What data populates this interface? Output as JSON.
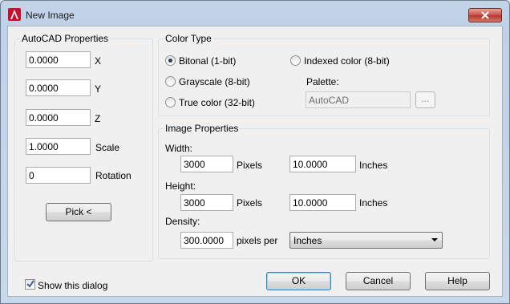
{
  "window": {
    "title": "New Image"
  },
  "insertion": {
    "group_title": "AutoCAD Properties",
    "x": {
      "value": "0.0000",
      "label": "X"
    },
    "y": {
      "value": "0.0000",
      "label": "Y"
    },
    "z": {
      "value": "0.0000",
      "label": "Z"
    },
    "scale": {
      "value": "1.0000",
      "label": "Scale"
    },
    "rotation": {
      "value": "0",
      "label": "Rotation"
    },
    "pick_label": "Pick <"
  },
  "color_type": {
    "group_title": "Color Type",
    "options": [
      {
        "label": "Bitonal (1-bit)",
        "checked": true
      },
      {
        "label": "Grayscale (8-bit)",
        "checked": false
      },
      {
        "label": "True color (32-bit)",
        "checked": false
      },
      {
        "label": "Indexed color (8-bit)",
        "checked": false
      }
    ],
    "palette_label": "Palette:",
    "palette_value": "AutoCAD",
    "browse_label": "..."
  },
  "image_properties": {
    "group_title": "Image Properties",
    "width": {
      "label": "Width:",
      "pixels": "3000",
      "pixels_unit": "Pixels",
      "inches": "10.0000",
      "inches_unit": "Inches"
    },
    "height": {
      "label": "Height:",
      "pixels": "3000",
      "pixels_unit": "Pixels",
      "inches": "10.0000",
      "inches_unit": "Inches"
    },
    "density": {
      "label": "Density:",
      "value": "300.0000",
      "unit_label": "pixels per",
      "unit_selected": "Inches"
    }
  },
  "footer": {
    "show_dialog_label": "Show this dialog",
    "show_dialog_checked": true,
    "ok_label": "OK",
    "cancel_label": "Cancel",
    "help_label": "Help"
  },
  "colors": {
    "titlebar": "#bfd2e8",
    "close_button": "#c75050",
    "client_bg": "#f0f0f0",
    "app_icon": "#c8102e"
  },
  "icons": {
    "app": "autocad-logo-icon",
    "close": "close-icon",
    "dropdown": "chevron-down-icon",
    "check": "checkmark-icon"
  }
}
